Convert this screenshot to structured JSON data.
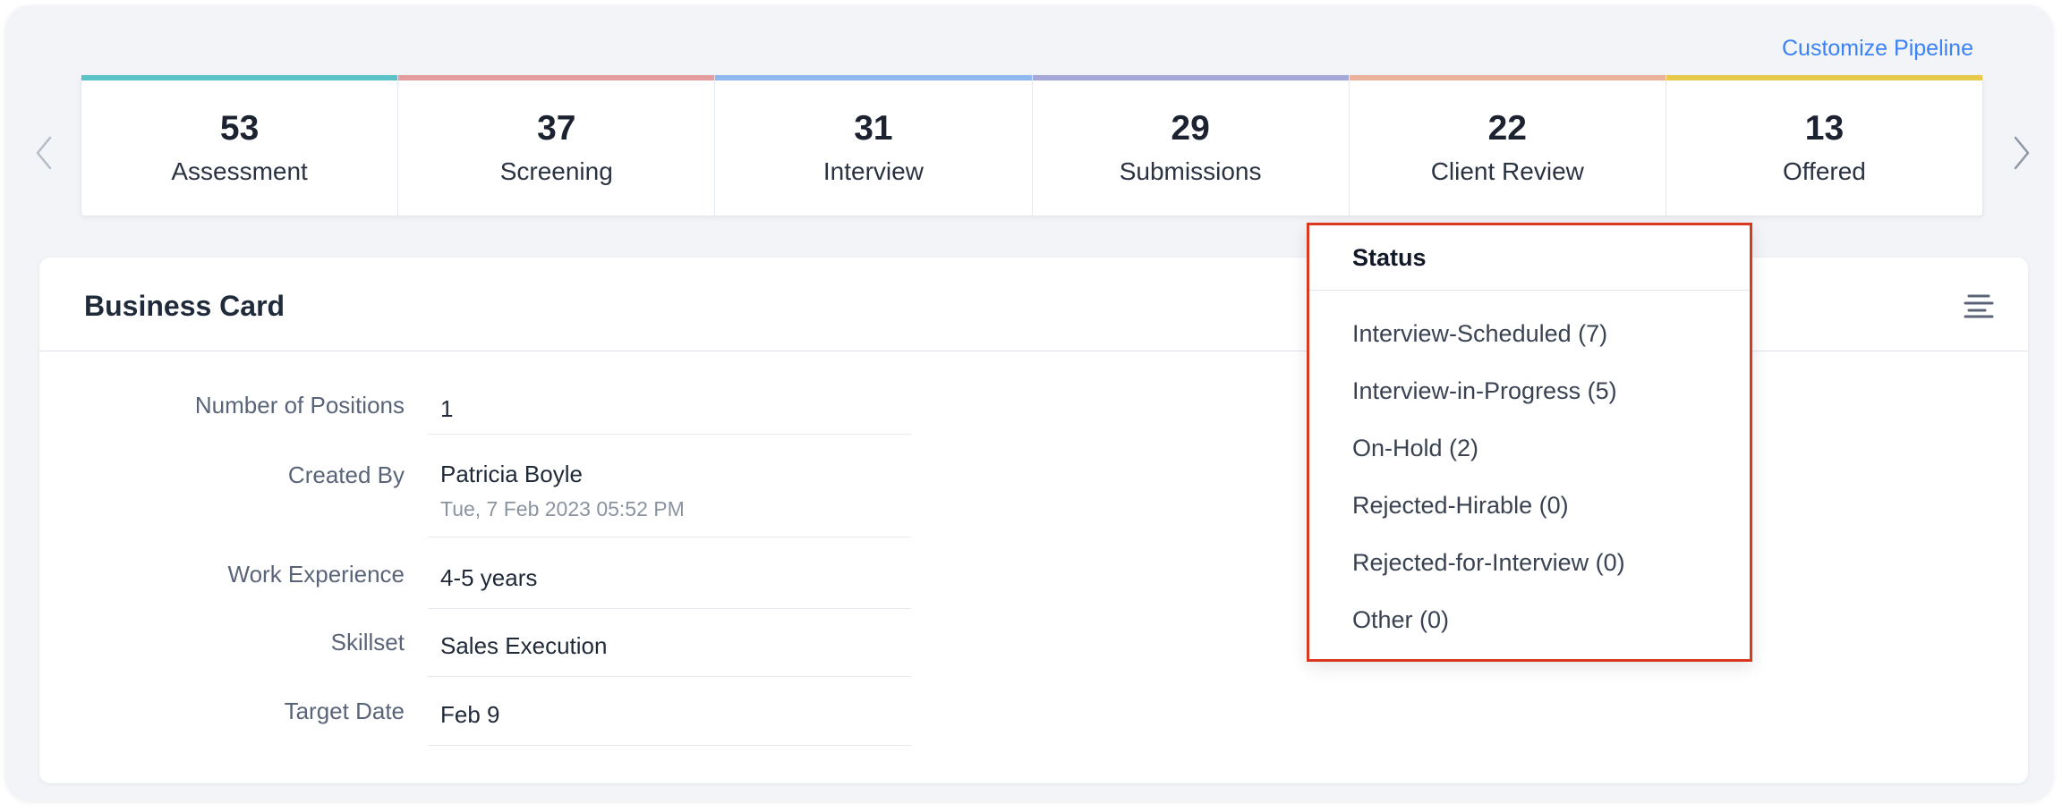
{
  "header": {
    "customize_label": "Customize Pipeline"
  },
  "pipeline": {
    "stages": [
      {
        "count": "53",
        "label": "Assessment",
        "color": "#5bc2c8"
      },
      {
        "count": "37",
        "label": "Screening",
        "color": "#e59c9f"
      },
      {
        "count": "31",
        "label": "Interview",
        "color": "#8fb8ef"
      },
      {
        "count": "29",
        "label": "Submissions",
        "color": "#a3a8d6"
      },
      {
        "count": "22",
        "label": "Client Review",
        "color": "#eab29b"
      },
      {
        "count": "13",
        "label": "Offered",
        "color": "#e9c94a"
      }
    ]
  },
  "card": {
    "title": "Business Card",
    "fields": [
      {
        "label": "Number of Positions",
        "value": "1"
      },
      {
        "label": "Created By",
        "value": "Patricia Boyle",
        "sub": "Tue, 7 Feb 2023 05:52 PM"
      },
      {
        "label": "Work Experience",
        "value": "4-5 years"
      },
      {
        "label": "Skillset",
        "value": "Sales Execution"
      },
      {
        "label": "Target Date",
        "value": "Feb 9"
      }
    ]
  },
  "status_dropdown": {
    "title": "Status",
    "items": [
      "Interview-Scheduled (7)",
      "Interview-in-Progress (5)",
      "On-Hold (2)",
      "Rejected-Hirable (0)",
      "Rejected-for-Interview (0)",
      "Other (0)"
    ]
  },
  "colors": {
    "accent": "#3b82f6",
    "highlight_border": "#d93a1f"
  }
}
